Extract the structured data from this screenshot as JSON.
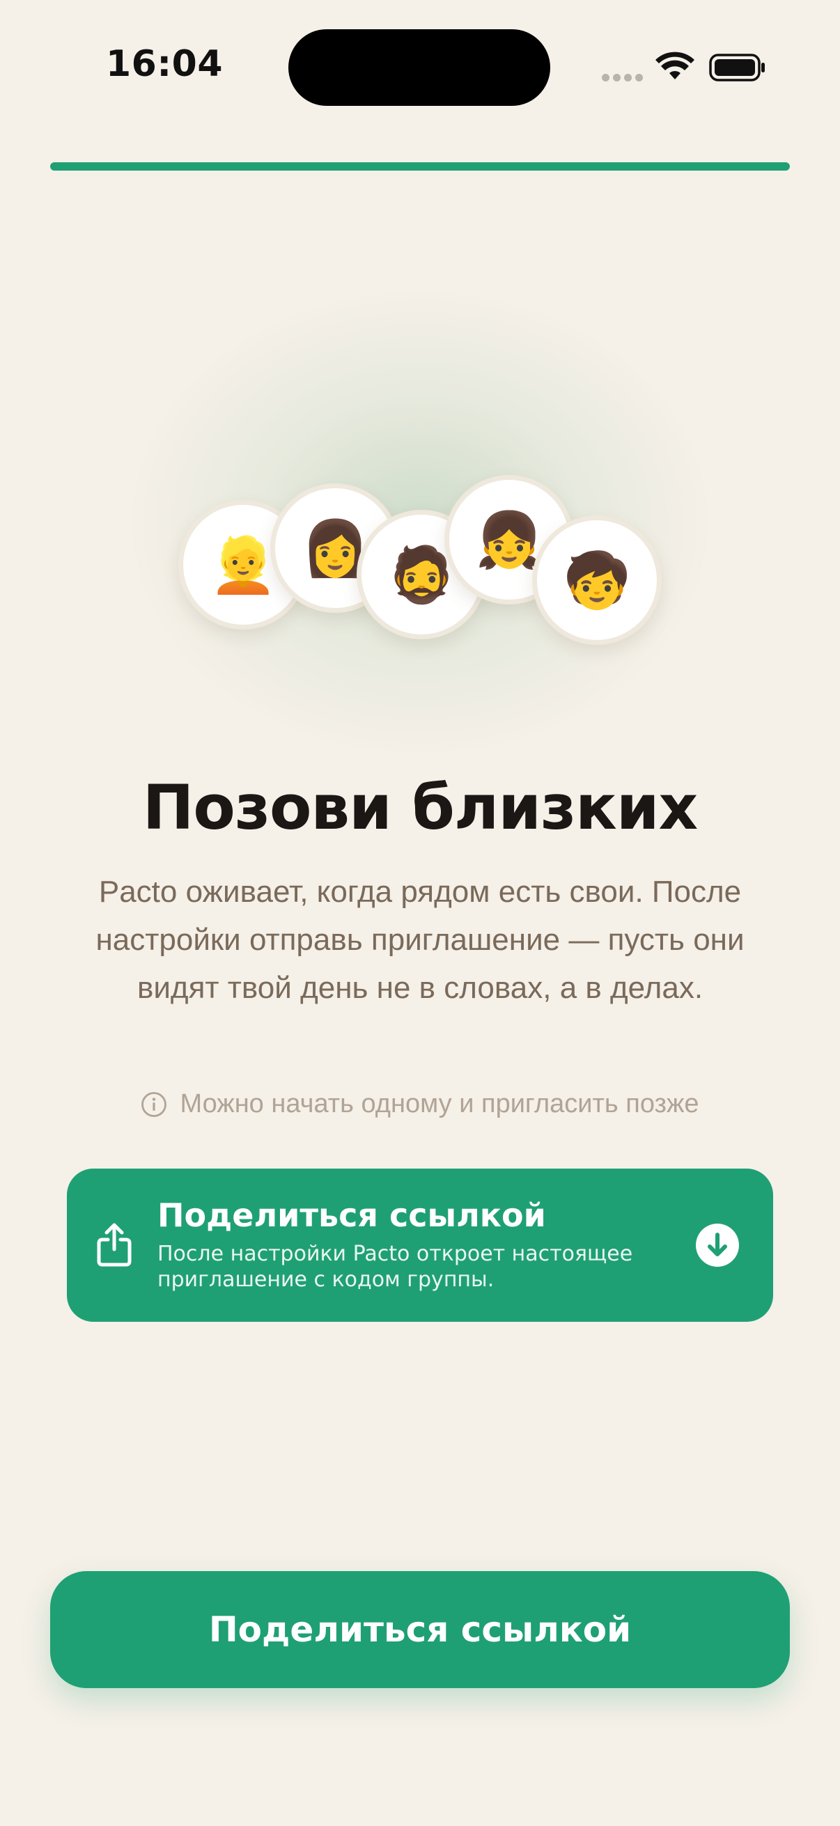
{
  "status_bar": {
    "time": "16:04",
    "icons": [
      "cellular-icon",
      "wifi-icon",
      "battery-icon"
    ]
  },
  "onboarding": {
    "progress": 1.0
  },
  "avatars": [
    {
      "emoji": "👱",
      "icon": "person-blond-icon"
    },
    {
      "emoji": "👩",
      "icon": "woman-icon"
    },
    {
      "emoji": "🧔",
      "icon": "bearded-person-icon"
    },
    {
      "emoji": "👧",
      "icon": "girl-icon"
    },
    {
      "emoji": "🧒",
      "icon": "child-icon"
    }
  ],
  "content": {
    "title": "Позови близких",
    "subtitle": "Pacto оживает, когда рядом есть свои. После настройки отправь приглашение — пусть они видят твой день не в словах, а в делах.",
    "hint": "Можно начать одному и пригласить позже"
  },
  "share_card": {
    "title": "Поделиться ссылкой",
    "description": "После настройки Pacto откроет настоящее приглашение с кодом группы.",
    "icon": "share-icon",
    "action_icon": "arrow-down-circle-icon"
  },
  "cta": {
    "label": "Поделиться ссылкой"
  },
  "colors": {
    "background": "#f5f0e8",
    "accent": "#1fa074",
    "title": "#1a1714",
    "subtitle": "#7a6a5a",
    "hint": "#b0a496"
  }
}
